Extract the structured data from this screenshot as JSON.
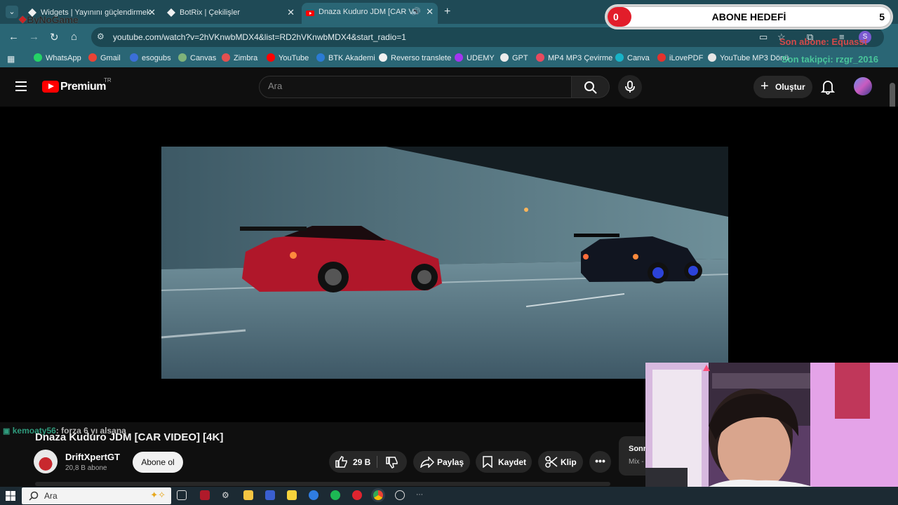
{
  "browser": {
    "tabs": [
      {
        "label": "Widgets | Yayınını güçlendirmek",
        "active": false
      },
      {
        "label": "BotRix | Çekilişler",
        "active": false
      },
      {
        "label": "Dnaza Kuduro JDM [CAR VI",
        "active": true
      }
    ],
    "new_tab": "+",
    "url": "youtube.com/watch?v=2hVKnwbMDX4&list=RD2hVKnwbMDX4&start_radio=1",
    "bookmarks": [
      {
        "label": "WhatsApp",
        "color": "#25d366"
      },
      {
        "label": "Gmail",
        "color": "#ea4335"
      },
      {
        "label": "esogubs",
        "color": "#3b6fd8"
      },
      {
        "label": "Canvas",
        "color": "#7fb37a"
      },
      {
        "label": "Zimbra",
        "color": "#e35050"
      },
      {
        "label": "YouTube",
        "color": "#ff0000"
      },
      {
        "label": "BTK Akademi",
        "color": "#2b7bd5"
      },
      {
        "label": "Reverso translete",
        "color": "#f2f2f2"
      },
      {
        "label": "UDEMY",
        "color": "#a435f0"
      },
      {
        "label": "GPT",
        "color": "#ececec"
      },
      {
        "label": "MP4 MP3 Çevirme",
        "color": "#e84a5f"
      },
      {
        "label": "Canva",
        "color": "#18b3c7"
      },
      {
        "label": "iLovePDF",
        "color": "#e5322d"
      },
      {
        "label": "YouTube MP3 Dönü",
        "color": "#e6e6e6"
      }
    ]
  },
  "overlay": {
    "brand": "ByNoGame",
    "goal_current": "0",
    "goal_title": "ABONE HEDEFİ",
    "goal_target": "5",
    "last_sub": "Son abone: Equasst",
    "last_follower": "Son takipçi: rzgr_2016",
    "chat_user": "kemoaty56",
    "chat_message": ": forza 6 yı alsana"
  },
  "youtube": {
    "brand": "Premium",
    "region": "TR",
    "search_placeholder": "Ara",
    "create_label": "Oluştur",
    "video_title": "Dnaza Kuduro JDM [CAR VIDEO] [4K]",
    "channel_name": "DriftXpertGT",
    "subscribers": "20,8 B abone",
    "subscribe_label": "Abone ol",
    "likes": "29 B",
    "share_label": "Paylaş",
    "save_label": "Kaydet",
    "clip_label": "Klip",
    "more_label": "•••",
    "next_title": "Sonr",
    "next_sub": "Mix -"
  },
  "taskbar": {
    "search_label": "Ara"
  }
}
